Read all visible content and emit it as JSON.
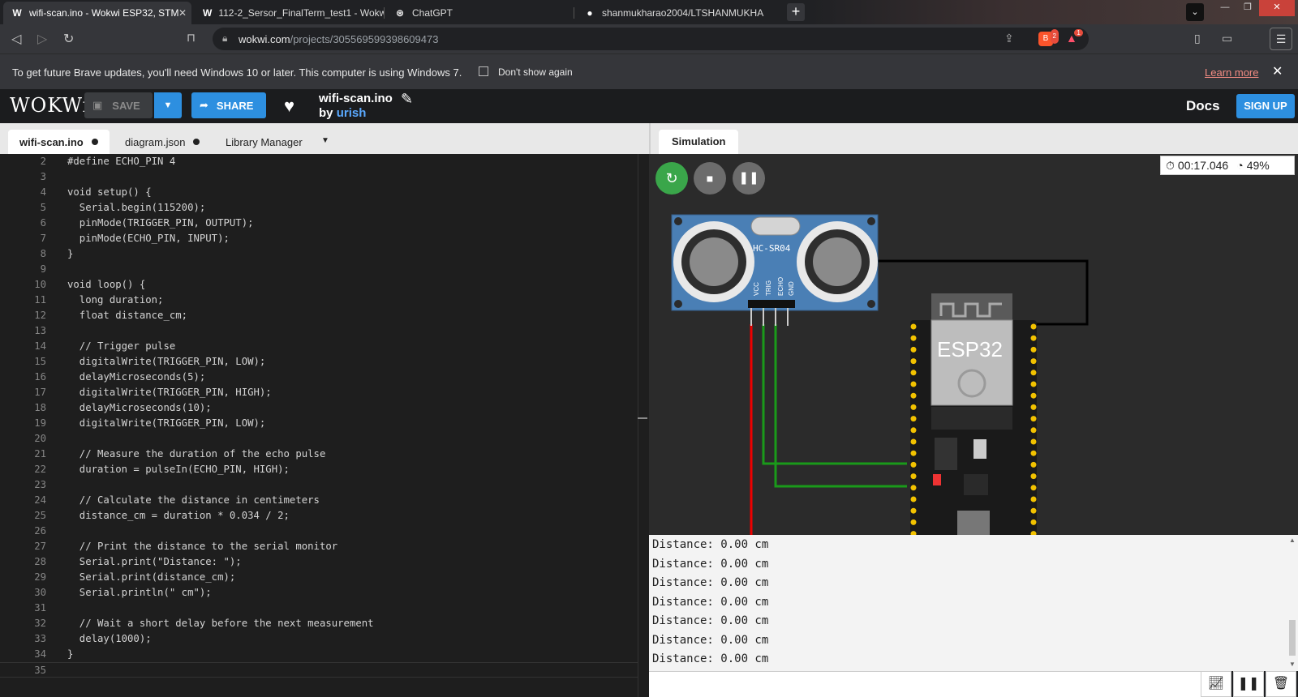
{
  "browser": {
    "tabs": [
      {
        "title": "wifi-scan.ino - Wokwi ESP32, STM",
        "icon": "wokwi-icon"
      },
      {
        "title": "112-2_Sersor_FinalTerm_test1 - Wokw",
        "icon": "wokwi-icon"
      },
      {
        "title": "ChatGPT",
        "icon": "chatgpt-icon"
      },
      {
        "title": "shanmukharao2004/LTSHANMUKHA",
        "icon": "github-icon"
      }
    ],
    "url_host": "wokwi.com",
    "url_path": "/projects/305569599398609473",
    "brave_badge": "2",
    "rewards_badge": "1"
  },
  "infobar": {
    "message": "To get future Brave updates, you'll need Windows 10 or later. This computer is using Windows 7.",
    "checkbox_label": "Don't show again",
    "learn_more": "Learn more"
  },
  "wokwi": {
    "logo": "WOKWi",
    "save_label": "SAVE",
    "share_label": "SHARE",
    "project_title": "wifi-scan.ino",
    "by_label": "by",
    "author": "urish",
    "docs_label": "Docs",
    "signup_label": "SIGN UP"
  },
  "editor": {
    "tabs": [
      "wifi-scan.ino",
      "diagram.json",
      "Library Manager"
    ],
    "lines": [
      {
        "n": "2",
        "t": "#define ECHO_PIN 4"
      },
      {
        "n": "3",
        "t": ""
      },
      {
        "n": "4",
        "t": "void setup() {"
      },
      {
        "n": "5",
        "t": "  Serial.begin(115200);"
      },
      {
        "n": "6",
        "t": "  pinMode(TRIGGER_PIN, OUTPUT);"
      },
      {
        "n": "7",
        "t": "  pinMode(ECHO_PIN, INPUT);"
      },
      {
        "n": "8",
        "t": "}"
      },
      {
        "n": "9",
        "t": ""
      },
      {
        "n": "10",
        "t": "void loop() {"
      },
      {
        "n": "11",
        "t": "  long duration;"
      },
      {
        "n": "12",
        "t": "  float distance_cm;"
      },
      {
        "n": "13",
        "t": ""
      },
      {
        "n": "14",
        "t": "  // Trigger pulse"
      },
      {
        "n": "15",
        "t": "  digitalWrite(TRIGGER_PIN, LOW);"
      },
      {
        "n": "16",
        "t": "  delayMicroseconds(5);"
      },
      {
        "n": "17",
        "t": "  digitalWrite(TRIGGER_PIN, HIGH);"
      },
      {
        "n": "18",
        "t": "  delayMicroseconds(10);"
      },
      {
        "n": "19",
        "t": "  digitalWrite(TRIGGER_PIN, LOW);"
      },
      {
        "n": "20",
        "t": ""
      },
      {
        "n": "21",
        "t": "  // Measure the duration of the echo pulse"
      },
      {
        "n": "22",
        "t": "  duration = pulseIn(ECHO_PIN, HIGH);"
      },
      {
        "n": "23",
        "t": ""
      },
      {
        "n": "24",
        "t": "  // Calculate the distance in centimeters"
      },
      {
        "n": "25",
        "t": "  distance_cm = duration * 0.034 / 2;"
      },
      {
        "n": "26",
        "t": ""
      },
      {
        "n": "27",
        "t": "  // Print the distance to the serial monitor"
      },
      {
        "n": "28",
        "t": "  Serial.print(\"Distance: \");"
      },
      {
        "n": "29",
        "t": "  Serial.print(distance_cm);"
      },
      {
        "n": "30",
        "t": "  Serial.println(\" cm\");"
      },
      {
        "n": "31",
        "t": ""
      },
      {
        "n": "32",
        "t": "  // Wait a short delay before the next measurement"
      },
      {
        "n": "33",
        "t": "  delay(1000);"
      },
      {
        "n": "34",
        "t": "}"
      },
      {
        "n": "35",
        "t": ""
      }
    ]
  },
  "simulation": {
    "tab_label": "Simulation",
    "timer": "00:17.046",
    "speed": "49%",
    "sensor_label": "HC-SR04",
    "sensor_pins": [
      "VCC",
      "TRIG",
      "ECHO",
      "GND"
    ],
    "board_label": "ESP32",
    "serial_lines": [
      "Distance: 0.00 cm",
      "Distance: 0.00 cm",
      "Distance: 0.00 cm",
      "Distance: 0.00 cm",
      "Distance: 0.00 cm",
      "Distance: 0.00 cm",
      "Distance: 0.00 cm"
    ]
  }
}
